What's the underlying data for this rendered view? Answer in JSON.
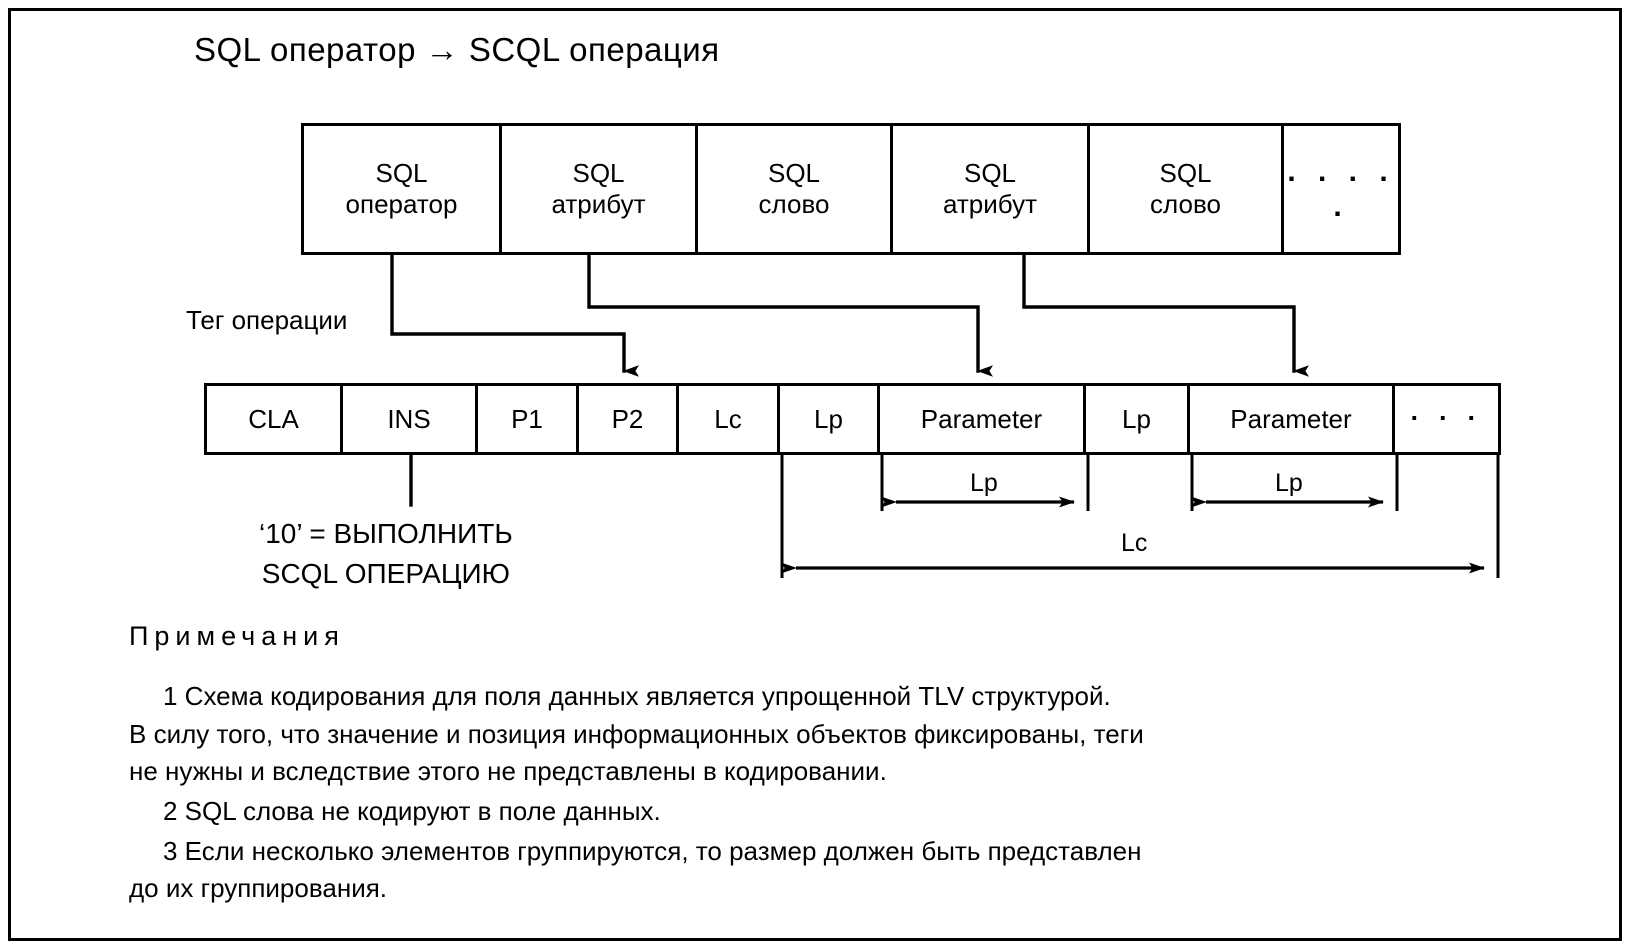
{
  "title": "SQL оператор  →  SCQL операция",
  "sql_row": {
    "name": "SQL statement structure",
    "cells": [
      {
        "line1": "SQL",
        "line2": "оператор"
      },
      {
        "line1": "SQL",
        "line2": "атрибут"
      },
      {
        "line1": "SQL",
        "line2": "слово"
      },
      {
        "line1": "SQL",
        "line2": "атрибут"
      },
      {
        "line1": "SQL",
        "line2": "слово"
      },
      {
        "line1": ". . . . .",
        "line2": ""
      }
    ]
  },
  "apdu_row": {
    "name": "APDU command structure",
    "cells": [
      {
        "label": "CLA"
      },
      {
        "label": "INS"
      },
      {
        "label": "P1"
      },
      {
        "label": "P2"
      },
      {
        "label": "Lc"
      },
      {
        "label": "Lp"
      },
      {
        "label": "Parameter"
      },
      {
        "label": "Lp"
      },
      {
        "label": "Parameter"
      },
      {
        "label": "· · ·"
      }
    ]
  },
  "labels": {
    "tag_operation": "Тег операции",
    "ins_callout_line1": "‘10’ = ВЫПОЛНИТЬ",
    "ins_callout_line2": "SCQL ОПЕРАЦИЮ",
    "lp1": "Lp",
    "lp2": "Lp",
    "lc": "Lc"
  },
  "notes": {
    "heading": "Примечания",
    "items": [
      {
        "lines": [
          "1 Схема кодирования для поля данных является упрощенной TLV структурой.",
          "В силу того, что значение и позиция информационных объектов фиксированы, теги",
          "не нужны и вследствие этого не представлены в кодировании."
        ]
      },
      {
        "lines": [
          "2 SQL слова не кодируют в поле данных."
        ]
      },
      {
        "lines": [
          "3 Если несколько элементов группируются, то размер должен быть представлен",
          "до их группирования."
        ]
      }
    ]
  },
  "colors": {
    "stroke": "#000000",
    "background": "#ffffff"
  }
}
